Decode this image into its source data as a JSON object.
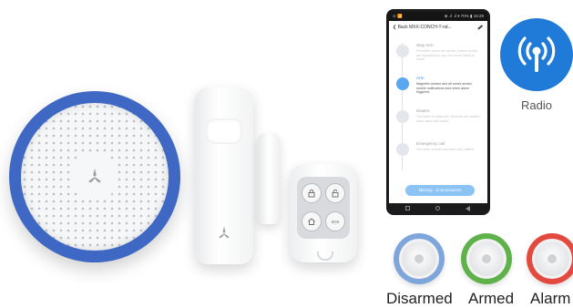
{
  "phone": {
    "status_left": "⊙ 📶",
    "status_right": "⊕ .ıl .ıl ▾ 70% ▮ 15:29",
    "back_label": "❮ Back",
    "header_title": "MXX-CONCH-T-nd...",
    "modes": [
      {
        "name": "Stay Arm",
        "desc": "Perimeter zones are armed, interior zones are bypassed so you can move freely at home.",
        "active": false
      },
      {
        "name": "Arm",
        "desc": "Magnetic contact and all zones armed, mobile notifications sent when alarm triggered.",
        "active": true
      },
      {
        "name": "Disarm",
        "desc": "The alarm is disarmed. Sensors are inactive, panic alarm still works.",
        "active": false
      },
      {
        "name": "Emergency call",
        "desc": "The siren sounds and users are notified.",
        "active": false
      }
    ],
    "bottom_button": "Missing  ·  in accessories"
  },
  "radio": {
    "label": "Radio",
    "icon": "radio-signal-icon",
    "color": "#1f7ad8"
  },
  "hub": {
    "ring_color": "#3f68c4"
  },
  "statuses": [
    {
      "label": "Disarmed",
      "color": "#7fa6db"
    },
    {
      "label": "Armed",
      "color": "#5fb24a"
    },
    {
      "label": "Alarm",
      "color": "#e4493f"
    }
  ]
}
